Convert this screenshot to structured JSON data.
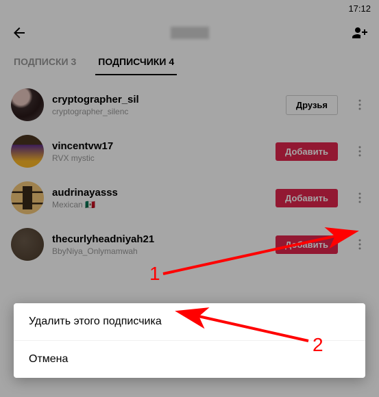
{
  "status": {
    "time": "17:12"
  },
  "tabs": {
    "subscriptions": {
      "label": "ПОДПИСКИ",
      "count": "3"
    },
    "followers": {
      "label": "ПОДПИСЧИКИ",
      "count": "4"
    }
  },
  "buttons": {
    "friends": "Друзья",
    "add": "Добавить"
  },
  "followers": [
    {
      "username": "cryptographer_sil",
      "subtitle": "cryptographer_silenc",
      "action": "friends"
    },
    {
      "username": "vincentvw17",
      "subtitle": "RVX mystic",
      "action": "add"
    },
    {
      "username": "audrinayasss",
      "subtitle": "Mexican 🇲🇽",
      "action": "add"
    },
    {
      "username": "thecurlyheadniyah21",
      "subtitle": "BbyNiya_Onlymamwah",
      "action": "add"
    }
  ],
  "sheet": {
    "remove": "Удалить этого подписчика",
    "cancel": "Отмена"
  },
  "annotations": {
    "step1": "1",
    "step2": "2"
  }
}
